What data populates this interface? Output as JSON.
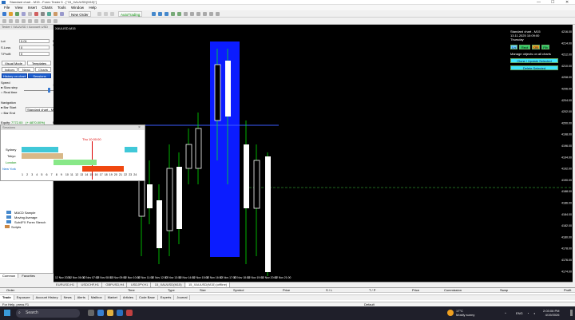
{
  "window": {
    "title": "Standard chart - M15 - Forex Tester 5 - [\"15_XAUUSD(M15)\"]",
    "minimize": "—",
    "maximize": "☐",
    "close": "✕"
  },
  "menu": [
    "File",
    "View",
    "Insert",
    "Charts",
    "Tools",
    "Window",
    "Help"
  ],
  "toolbar": {
    "new_order": "New Order",
    "auto_trading": "AutoTrading"
  },
  "left_panel": {
    "header": "Tester / XAUUSD / Account USD",
    "fields": [
      {
        "label": "Lot",
        "value": "0.01"
      },
      {
        "label": "S.Loss",
        "value": "0"
      },
      {
        "label": "T.Profit",
        "value": "0"
      }
    ],
    "tabs": [
      "Market",
      "Pending",
      "Presets",
      "Account",
      "Stats"
    ],
    "buy": {
      "label": "Buy M",
      "price": "4195.84"
    },
    "sell": {
      "label": "Sell M",
      "price": "4195.39"
    },
    "date_time": "Thu, 13/11/2025  10:09:00",
    "speed": "Speed: 15 pips",
    "buttons": {
      "visual_mode": "Visual Mode",
      "templates": "Templates",
      "close_limit": "Close Limit",
      "close_all": "Close All",
      "indices": "Indices",
      "news": "News",
      "charts": "Charts",
      "history_on_chart": "History on chart",
      "sessions": "Sessions"
    },
    "speed_label": "Speed",
    "speed_options": [
      "Slow step",
      "Real time"
    ],
    "ticks_label": "15 ticks/sec",
    "navigation_label": "Navigation",
    "nav_options": [
      "Bar Start",
      "Bar End"
    ],
    "chart_select": "Standard chart - M15",
    "next_bar": "Next Bar",
    "prev_bar": "< Prev Bar",
    "equity_label": "Equity:",
    "equity_value": "7772.00",
    "equity_pct": "(+ 4870.00%)",
    "floating_label": "Floating P/L:",
    "floating_value": "353.47"
  },
  "sessions": {
    "header": "Sessions",
    "day_label": "Thu 10:00:00",
    "rows": [
      {
        "name": "Sydney",
        "color": "#40c8d8"
      },
      {
        "name": "Tokyo",
        "color": "#d8b888"
      },
      {
        "name": "London",
        "color": "#88e888"
      },
      {
        "name": "New York",
        "color": "#f04810"
      }
    ],
    "hours": [
      "1",
      "2",
      "3",
      "4",
      "5",
      "6",
      "7",
      "8",
      "9",
      "10",
      "11",
      "12",
      "13",
      "14",
      "15",
      "16",
      "17",
      "18",
      "19",
      "20",
      "21",
      "22",
      "23",
      "24"
    ]
  },
  "navigator": {
    "items": [
      "MACD Sample",
      "Moving Average",
      "Suh4FX Forex Stench",
      "Scripts"
    ],
    "tabs": [
      "Common",
      "Favorites"
    ]
  },
  "chart": {
    "symbol_label": "XAUUSD,M15",
    "info": {
      "title": "Standard chart - M15",
      "date": "13.11.2025  10:09:00",
      "day": "Thursday"
    },
    "buttons": {
      "tb1": "Ln",
      "tb2": "Rect",
      "tb3": "OB",
      "tb4": "Fib",
      "manage": "Manage objects on all charts",
      "clone_update": "Clone / Update Selected",
      "delete_selected": "Delete Selected"
    },
    "x_labels": [
      "12 Nov 2025",
      "12 Nov 06:00",
      "12 Nov 07:00",
      "12 Nov 08:00",
      "12 Nov 09:00",
      "12 Nov 10:00",
      "12 Nov 11:00",
      "12 Nov 12:00",
      "12 Nov 13:00",
      "12 Nov 14:00",
      "12 Nov 15:00",
      "12 Nov 16:00",
      "12 Nov 17:00",
      "12 Nov 18:00",
      "12 Nov 19:00",
      "12 Nov 20:00",
      "12 Nov 21:00"
    ],
    "y_labels": [
      "4216.00",
      "4214.00",
      "4212.00",
      "4210.00",
      "4208.00",
      "4206.00",
      "4204.00",
      "4202.00",
      "4200.00",
      "4198.00",
      "4196.00",
      "4194.00",
      "4192.00",
      "4190.00",
      "4188.00",
      "4186.00",
      "4184.00",
      "4182.00",
      "4180.00",
      "4178.00",
      "4176.00",
      "4174.00"
    ],
    "tabs": [
      "EURUSD,H1",
      "USDCHF,H1",
      "GBPUSD,H4",
      "USDJPY,H1",
      "15_XAUUSD(M15)",
      "15_XAUUSD(M15) (offline)"
    ]
  },
  "terminal": {
    "columns": [
      "Order",
      "Time",
      "Type",
      "Size",
      "Symbol",
      "Price",
      "S / L",
      "T / P",
      "Price",
      "Commission",
      "Swap",
      "Profit"
    ],
    "balance_line": "Balance: 10 000.00 EUR  Equity: 10 000.00  Free margin: 10 000.00",
    "tabs": [
      "Trade",
      "Exposure",
      "Account History",
      "News",
      "Alerts",
      "Mailbox",
      "Market",
      "Articles",
      "Code Base",
      "Experts",
      "Journal"
    ]
  },
  "status": {
    "left": "For Help, press F1",
    "right": "Default"
  },
  "taskbar": {
    "search": "Search",
    "weather_temp": "17°C",
    "weather_text": "Mostly sunny",
    "lang": "ENG",
    "time": "2:03:06 PM",
    "date": "4/19/2026"
  }
}
